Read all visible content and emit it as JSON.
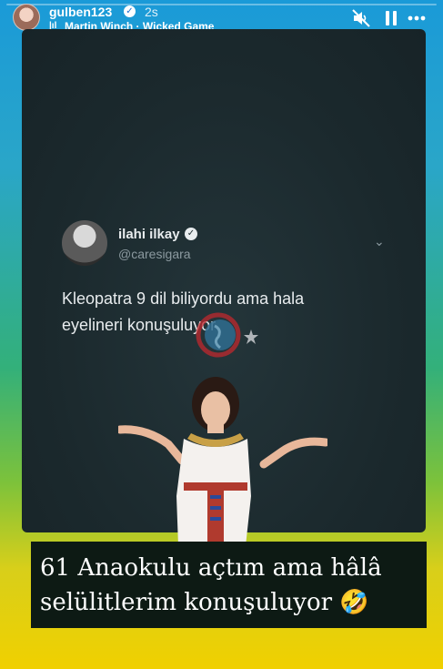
{
  "story": {
    "progress_fraction": 0.0,
    "username": "gulben123",
    "timestamp": "2s",
    "music_icon": "music-bars-icon",
    "music_label": "Martin Winch · Wicked Game"
  },
  "controls": {
    "mute_icon": "speaker-muted-icon",
    "pause_icon": "pause-icon",
    "more_icon": "more-dots-icon"
  },
  "tweet": {
    "display_name": "ilahi ilkay",
    "handle": "@caresigara",
    "text_line1": "Kleopatra 9 dil biliyordu ama hala",
    "text_line2": "eyelineri konuşuluyor"
  },
  "caption": {
    "line1": "61 Anaokulu açtım ama hâlâ",
    "line2": "selülitlerim konuşuluyor 🤣"
  },
  "colors": {
    "card_bg": "#1b292d",
    "caption_bg": "#0d1a14",
    "verified_blue": "#1d6fd0"
  }
}
